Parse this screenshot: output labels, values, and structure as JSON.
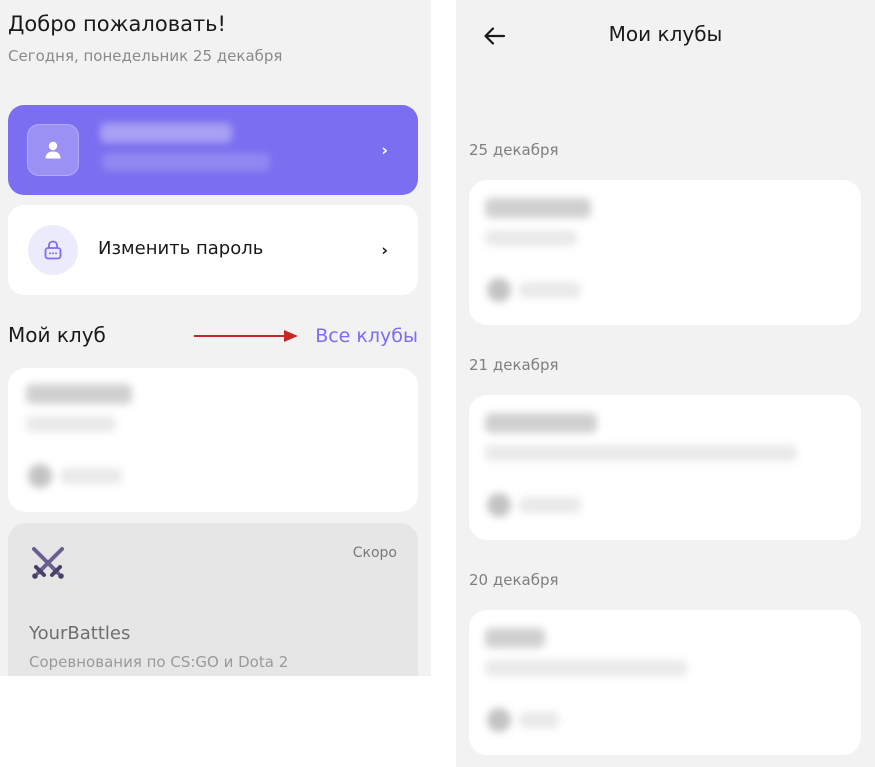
{
  "left_screen": {
    "welcome_title": "Добро пожаловать!",
    "welcome_date": "Сегодня, понедельник 25 декабря",
    "profile_card": {
      "avatar_icon": "user-icon",
      "chevron": "›"
    },
    "password_card": {
      "label": "Изменить пароль",
      "icon": "lock-icon",
      "chevron": "›"
    },
    "club_section": {
      "heading": "Мой клуб",
      "all_clubs_link": "Все клубы"
    },
    "battles_card": {
      "icon": "crossed-swords-icon",
      "badge": "Скоро",
      "title": "YourBattles",
      "description": "Соревнования по CS:GO и Dota 2"
    }
  },
  "right_screen": {
    "title": "Мои клубы",
    "back_icon": "arrow-left-icon",
    "groups": [
      {
        "date": "25 декабря"
      },
      {
        "date": "21 декабря"
      },
      {
        "date": "20 декабря"
      }
    ]
  },
  "colors": {
    "accent": "#7b6ef0",
    "background": "#f2f2f2",
    "card": "#ffffff",
    "annotation_arrow": "#c62828"
  }
}
